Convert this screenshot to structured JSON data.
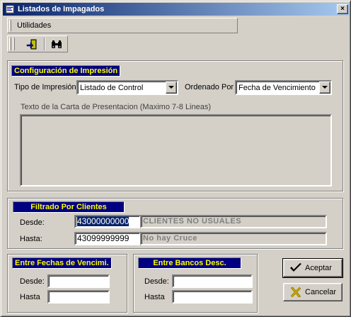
{
  "window": {
    "title": "Listados de Impagados",
    "close_glyph": "×"
  },
  "menubar": {
    "utilidades_label": "Utilidades"
  },
  "toolbar": {
    "buttons": [
      {
        "icon": "exit-door-icon"
      },
      {
        "icon": "binoculars-icon"
      }
    ]
  },
  "config": {
    "title": "Configuración de Impresión",
    "tipo_label": "Tipo de Impresión",
    "tipo_value": "Listado de Control",
    "ordenado_label": "Ordenado Por",
    "ordenado_value": "Fecha de Vencimiento",
    "texto_label": "Texto de la Carta de Presentacion (Maximo 7-8 Lineas)",
    "texto_value": ""
  },
  "filtrado": {
    "title": "Filtrado Por Clientes",
    "desde_label": "Desde:",
    "desde_value": "43000000000",
    "desde_desc": "CLIENTES NO USUALES",
    "hasta_label": "Hasta:",
    "hasta_value": "43099999999",
    "hasta_desc": "No hay Cruce"
  },
  "fechas": {
    "title": "Entre Fechas de Vencimi.",
    "desde_label": "Desde:",
    "desde_value": "",
    "hasta_label": "Hasta",
    "hasta_value": ""
  },
  "bancos": {
    "title": "Entre Bancos Desc.",
    "desde_label": "Desde:",
    "desde_value": "",
    "hasta_label": "Hasta",
    "hasta_value": ""
  },
  "actions": {
    "aceptar_label": "Aceptar",
    "cancelar_label": "Cancelar"
  },
  "colors": {
    "title_bar": "#0a246a",
    "group_title_bg": "#000080",
    "group_title_fg": "#ffff00",
    "selection": "#0a246a"
  }
}
